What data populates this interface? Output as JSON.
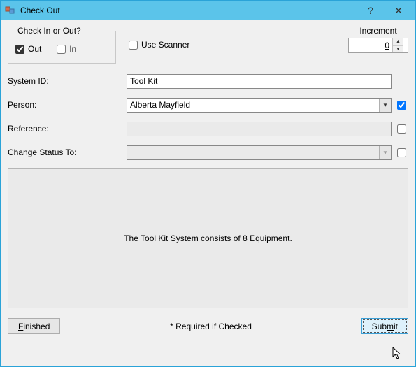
{
  "window": {
    "title": "Check Out"
  },
  "checkGroup": {
    "legend": "Check In or Out?",
    "out_label": "Out",
    "out_checked": true,
    "in_label": "In",
    "in_checked": false
  },
  "useScanner": {
    "label": "Use Scanner",
    "checked": false
  },
  "increment": {
    "label": "Increment",
    "value": "0"
  },
  "rows": {
    "systemId": {
      "label": "System ID:",
      "value": "Tool Kit"
    },
    "person": {
      "label": "Person:",
      "value": "Alberta Mayfield",
      "check": true
    },
    "reference": {
      "label": "Reference:",
      "value": "",
      "check": false
    },
    "status": {
      "label": "Change Status To:",
      "value": "",
      "check": false
    }
  },
  "panel": {
    "message": "The Tool Kit System consists of 8 Equipment."
  },
  "footer": {
    "finished_mn": "F",
    "finished_rest": "inished",
    "required_note": "* Required if Checked",
    "submit_pre": "Sub",
    "submit_mn": "m",
    "submit_post": "it"
  }
}
